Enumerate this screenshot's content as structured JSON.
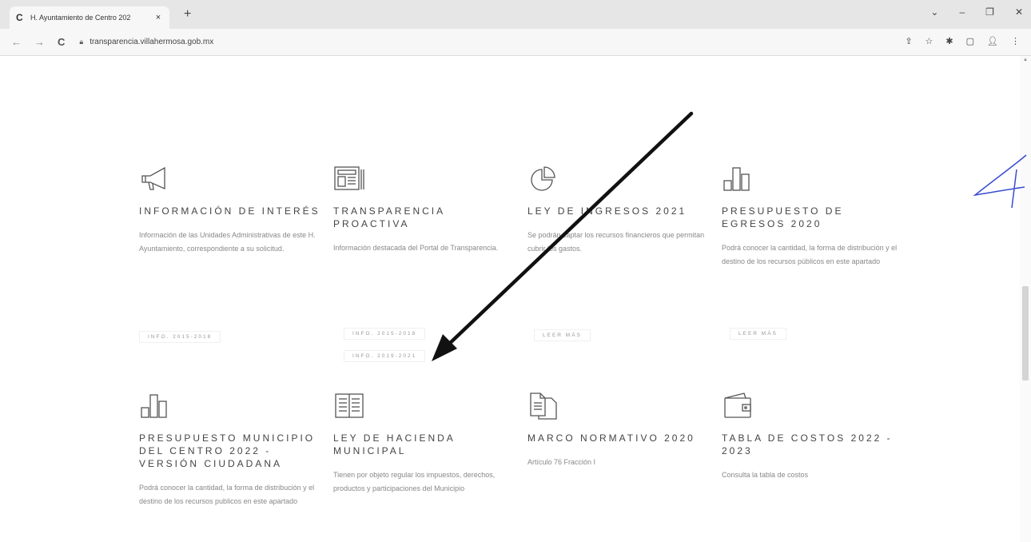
{
  "browser": {
    "tab_favicon": "C",
    "tab_title": "H. Ayuntamiento de Centro 202",
    "tab_close": "×",
    "new_tab": "+",
    "url": "transparencia.villahermosa.gob.mx",
    "window_controls": [
      "⌄",
      "–",
      "❐",
      "✕"
    ]
  },
  "cards": [
    {
      "title": "INFORMACIÓN DE INTERÉS",
      "desc": "Información de las Unidades Administrativas de este H. Ayuntamiento, correspondiente a su solicitud.",
      "buttons": [
        "INFO. 2015-2018"
      ],
      "icon": "megaphone-icon"
    },
    {
      "title": "TRANSPARENCIA PROACTIVA",
      "desc": "Información destacada del Portal de Transparencia.",
      "buttons": [
        "INFO. 2015-2018",
        "INFO. 2019-2021"
      ],
      "icon": "newspaper-icon"
    },
    {
      "title": "LEY DE INGRESOS 2021",
      "desc": "Se podrán captar los recursos financieros que permitan cubrir los gastos.",
      "buttons": [
        "LEER MÁS"
      ],
      "icon": "pie-chart-icon"
    },
    {
      "title": "PRESUPUESTO DE EGRESOS 2020",
      "desc": "Podrá conocer la cantidad, la forma de distribución y el destino de los recursos públicos en este apartado",
      "buttons": [
        "LEER MÁS"
      ],
      "icon": "bar-chart-icon"
    },
    {
      "title": "PRESUPUESTO MUNICIPIO DEL CENTRO 2022 - VERSIÓN CIUDADANA",
      "desc": "Podrá conocer la cantidad, la forma de distribución y el destino de los recursos publicos en este apartado",
      "buttons": [],
      "icon": "bar-chart-icon"
    },
    {
      "title": "LEY DE HACIENDA MUNICIPAL",
      "desc": "Tienen por objeto regular los impuestos, derechos, productos y participaciones del Municipio",
      "buttons": [],
      "icon": "book-icon"
    },
    {
      "title": "MARCO NORMATIVO 2020",
      "desc": "Artículo 76 Fracción I",
      "buttons": [],
      "icon": "documents-icon"
    },
    {
      "title": "TABLA DE COSTOS 2022 - 2023",
      "desc": "Consulta la tabla de costos",
      "buttons": [],
      "icon": "wallet-icon"
    }
  ],
  "colors": {
    "text": "#444444",
    "muted": "#888888",
    "annotation": "#111111",
    "signature": "#3a4bd1"
  }
}
